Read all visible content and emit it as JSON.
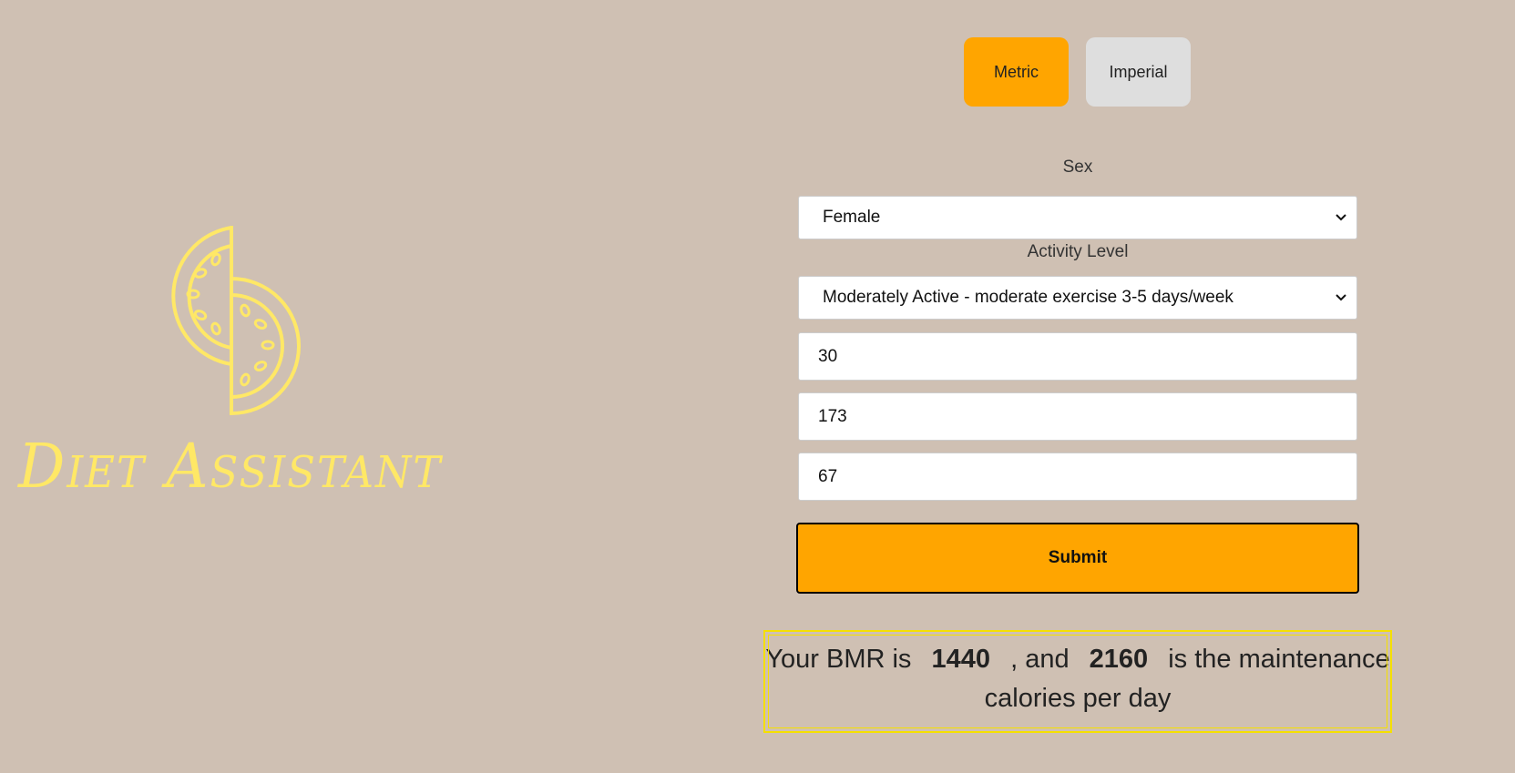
{
  "brand": {
    "name": "Diet Assistant",
    "logo_icon": "watermelon-slices-icon",
    "color": "#ffe866"
  },
  "units": {
    "metric_label": "Metric",
    "imperial_label": "Imperial",
    "selected": "Metric",
    "active_color": "#ffa500"
  },
  "form": {
    "sex_label": "Sex",
    "sex_value": "Female",
    "activity_label": "Activity Level",
    "activity_value": "Moderately Active - moderate exercise 3-5 days/week",
    "age_value": "30",
    "height_value": "173",
    "weight_value": "67",
    "submit_label": "Submit"
  },
  "result": {
    "prefix": "Your BMR is",
    "bmr": "1440",
    "middle": ", and",
    "maintenance": "2160",
    "suffix": "is the maintenance calories per day"
  }
}
